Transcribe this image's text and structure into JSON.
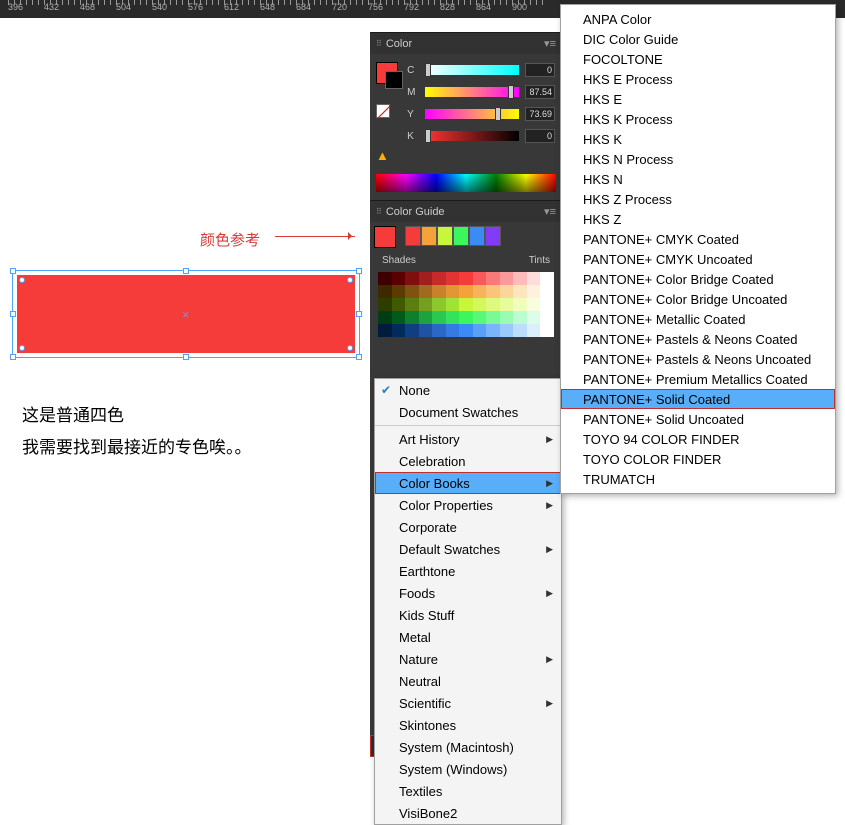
{
  "ruler": {
    "ticks": [
      "396",
      "432",
      "468",
      "504",
      "540",
      "576",
      "612",
      "648",
      "684",
      "720",
      "756",
      "792",
      "828",
      "864",
      "900"
    ]
  },
  "annotation": {
    "label": "颜色参考"
  },
  "caption": {
    "line1": "这是普通四色",
    "line2": "我需要找到最接近的专色唉。。"
  },
  "color_panel": {
    "title": "Color",
    "channels": [
      {
        "label": "C",
        "value": "0",
        "pos": 0,
        "track": "c"
      },
      {
        "label": "M",
        "value": "87.54",
        "pos": 88,
        "track": "m"
      },
      {
        "label": "Y",
        "value": "73.69",
        "pos": 74,
        "track": "y"
      },
      {
        "label": "K",
        "value": "0",
        "pos": 0,
        "track": "k"
      }
    ]
  },
  "guide_panel": {
    "title": "Color Guide",
    "shades_label": "Shades",
    "tints_label": "Tints",
    "harmonies": [
      "#f63b3b",
      "#f6a23b",
      "#c8f63b",
      "#3bf65c",
      "#3b8bf6",
      "#823bf6"
    ],
    "grid": [
      [
        "#3d0000",
        "#5a0000",
        "#7f0f0f",
        "#a11f1f",
        "#c82a2a",
        "#e33434",
        "#f63b3b",
        "#f85a5a",
        "#fa7a7a",
        "#fc9a9a",
        "#fdbbbb",
        "#fedcdc",
        "#fff"
      ],
      [
        "#3d2800",
        "#5a3b00",
        "#7f530f",
        "#a16b1f",
        "#c8832a",
        "#e39634",
        "#f6a23b",
        "#f8b35a",
        "#fac47a",
        "#fcd59a",
        "#fde6bb",
        "#fef2dc",
        "#fff"
      ],
      [
        "#2b3d00",
        "#405a00",
        "#5a7f0f",
        "#73a11f",
        "#8cc82a",
        "#a1e334",
        "#c8f63b",
        "#d2f85a",
        "#ddfa7a",
        "#e7fc9a",
        "#f1fdbb",
        "#f8fedc",
        "#fff"
      ],
      [
        "#003d12",
        "#005a1c",
        "#0f7f2d",
        "#1fa13e",
        "#2ac850",
        "#34e35c",
        "#3bf65c",
        "#5af879",
        "#7afa96",
        "#9afcb3",
        "#bbfdd0",
        "#dcfee9",
        "#fff"
      ],
      [
        "#001c3d",
        "#002b5a",
        "#0f3f7f",
        "#1f53a1",
        "#2a68c8",
        "#347be3",
        "#3b8bf6",
        "#5aa0f8",
        "#7ab5fa",
        "#9acafc",
        "#bbdefd",
        "#dceffe",
        "#fff"
      ]
    ],
    "library": {
      "label": "None"
    }
  },
  "library_menu": {
    "items": [
      {
        "label": "None",
        "checked": true
      },
      {
        "label": "Document Swatches"
      },
      {
        "label": "Art History",
        "sub": true
      },
      {
        "label": "Celebration"
      },
      {
        "label": "Color Books",
        "sub": true,
        "hl": true
      },
      {
        "label": "Color Properties",
        "sub": true
      },
      {
        "label": "Corporate"
      },
      {
        "label": "Default Swatches",
        "sub": true
      },
      {
        "label": "Earthtone"
      },
      {
        "label": "Foods",
        "sub": true
      },
      {
        "label": "Kids Stuff"
      },
      {
        "label": "Metal"
      },
      {
        "label": "Nature",
        "sub": true
      },
      {
        "label": "Neutral"
      },
      {
        "label": "Scientific",
        "sub": true
      },
      {
        "label": "Skintones"
      },
      {
        "label": "System (Macintosh)"
      },
      {
        "label": "System (Windows)"
      },
      {
        "label": "Textiles"
      },
      {
        "label": "VisiBone2"
      }
    ]
  },
  "colorbook_menu": {
    "items": [
      {
        "label": "ANPA Color"
      },
      {
        "label": "DIC Color Guide"
      },
      {
        "label": "FOCOLTONE"
      },
      {
        "label": "HKS E Process"
      },
      {
        "label": "HKS E"
      },
      {
        "label": "HKS K Process"
      },
      {
        "label": "HKS K"
      },
      {
        "label": "HKS N Process"
      },
      {
        "label": "HKS N"
      },
      {
        "label": "HKS Z Process"
      },
      {
        "label": "HKS Z"
      },
      {
        "label": "PANTONE+ CMYK Coated"
      },
      {
        "label": "PANTONE+ CMYK Uncoated"
      },
      {
        "label": "PANTONE+ Color Bridge Coated"
      },
      {
        "label": "PANTONE+ Color Bridge Uncoated"
      },
      {
        "label": "PANTONE+ Metallic Coated"
      },
      {
        "label": "PANTONE+ Pastels & Neons Coated"
      },
      {
        "label": "PANTONE+ Pastels & Neons Uncoated"
      },
      {
        "label": "PANTONE+ Premium Metallics Coated"
      },
      {
        "label": "PANTONE+ Solid Coated",
        "hl": true
      },
      {
        "label": "PANTONE+ Solid Uncoated"
      },
      {
        "label": "TOYO 94 COLOR FINDER"
      },
      {
        "label": "TOYO COLOR FINDER"
      },
      {
        "label": "TRUMATCH"
      }
    ]
  }
}
